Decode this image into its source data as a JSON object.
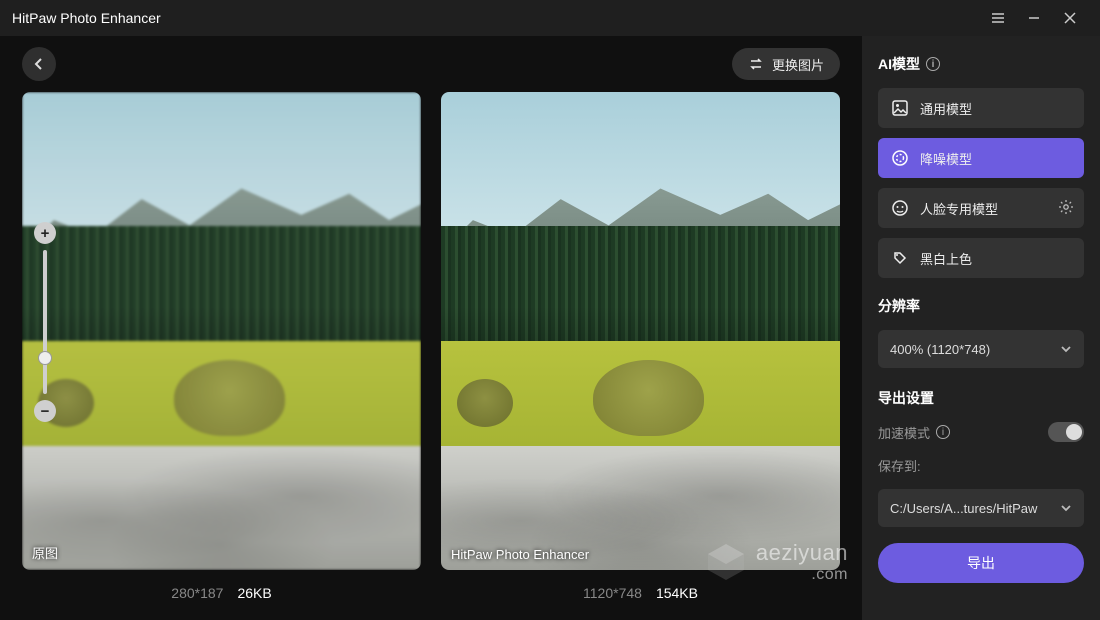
{
  "app": {
    "title": "HitPaw Photo Enhancer"
  },
  "header": {
    "swap_label": "更换图片"
  },
  "images": {
    "original": {
      "label": "原图",
      "dimensions": "280*187",
      "filesize": "26KB"
    },
    "enhanced": {
      "label": "HitPaw Photo Enhancer",
      "dimensions": "1120*748",
      "filesize": "154KB"
    }
  },
  "sidebar": {
    "ai_section": "AI模型",
    "models": [
      {
        "label": "通用模型",
        "icon": "image-icon"
      },
      {
        "label": "降噪模型",
        "icon": "denoise-icon",
        "active": true
      },
      {
        "label": "人脸专用模型",
        "icon": "face-icon",
        "has_settings": true
      },
      {
        "label": "黑白上色",
        "icon": "colorize-icon"
      }
    ],
    "resolution_section": "分辨率",
    "resolution_value": "400% (1120*748)",
    "export_section": "导出设置",
    "accel_label": "加速模式",
    "save_to_label": "保存到:",
    "save_to_value": "C:/Users/A...tures/HitPaw",
    "export_btn": "导出"
  },
  "watermark": {
    "text": "aeziyuan",
    "suffix": ".com"
  }
}
